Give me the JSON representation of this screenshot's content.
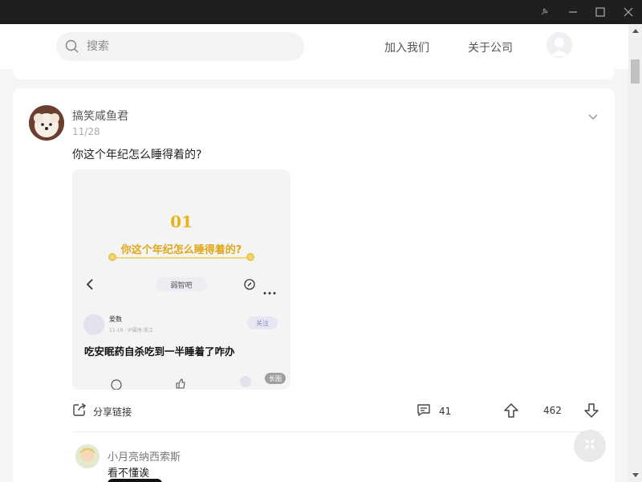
{
  "header": {
    "search_placeholder": "搜索",
    "nav": [
      "加入我们",
      "关于公司"
    ]
  },
  "post": {
    "author": "搞笑咸鱼君",
    "date": "11/28",
    "title": "你这个年纪怎么睡得着的?",
    "image": {
      "number": "01",
      "question": "你这个年纪怎么睡得着的?",
      "forum": "弱智吧",
      "inner_user": "爱数",
      "inner_meta": "11-18 · IP属地:浙江",
      "follow": "关注",
      "inner_text": "吃安眠药自杀吃到一半睡着了咋办",
      "long_badge": "长图"
    },
    "share_label": "分享链接",
    "comment_count": "41",
    "vote_count": "462"
  },
  "comment": {
    "author": "小月亮纳西索斯",
    "text": "看不懂诶"
  },
  "colors": {
    "accent_gold": "#e8b21a",
    "titlebar": "#1f1f1f"
  }
}
